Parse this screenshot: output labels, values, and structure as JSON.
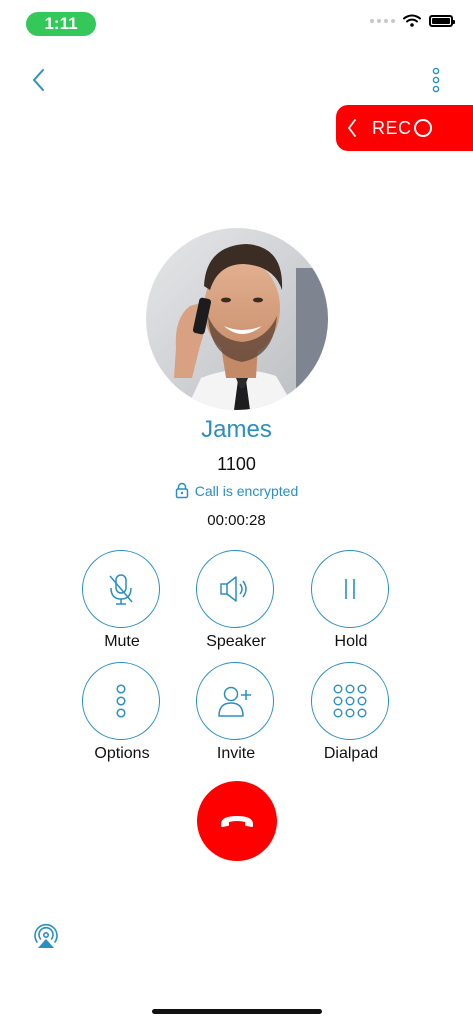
{
  "status_bar": {
    "time": "1:11"
  },
  "record": {
    "label": "REC"
  },
  "caller": {
    "name": "James",
    "number": "1100",
    "encryption_text": "Call is encrypted",
    "duration": "00:00:28"
  },
  "actions": {
    "mute": "Mute",
    "speaker": "Speaker",
    "hold": "Hold",
    "options": "Options",
    "invite": "Invite",
    "dialpad": "Dialpad"
  },
  "colors": {
    "accent": "#2a8fc3",
    "record_bg": "#ff0000",
    "hangup_bg": "#ff0000",
    "time_pill": "#34c759"
  },
  "icons": {
    "back": "chevron-left-icon",
    "more": "more-vertical-icon",
    "mute": "mic-off-icon",
    "speaker": "speaker-icon",
    "hold": "pause-icon",
    "options": "dots-vertical-icon",
    "invite": "add-user-icon",
    "dialpad": "dialpad-icon",
    "hangup": "phone-hangup-icon",
    "airplay": "airplay-icon"
  }
}
